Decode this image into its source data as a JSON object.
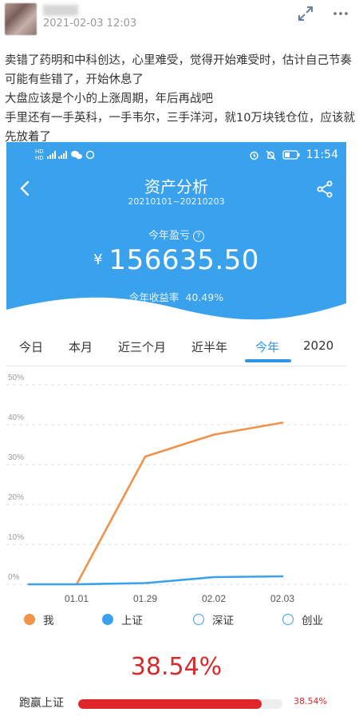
{
  "post": {
    "timestamp": "2021-02-03 12:03",
    "lines": [
      "卖错了药明和中科创达，心里难受，觉得开始难受时，估计自己节奏可能有些错了，开始休息了",
      "大盘应该是个小的上涨周期，年后再战吧",
      "手里还有一手英科，一手韦尔，三手洋河，就10万块钱仓位，应该就先放着了"
    ]
  },
  "phone": {
    "status": {
      "time": "11:54",
      "left_labels": [
        "HD",
        "4G",
        "HD",
        "4G"
      ]
    },
    "header": {
      "title": "资产分析",
      "date_range": "20210101~20210203",
      "profit_label": "今年盈亏",
      "currency": "¥",
      "amount": "156635.50",
      "rate_label": "今年收益率",
      "rate_value": "40.49%"
    },
    "tabs": [
      "今日",
      "本月",
      "近三个月",
      "近半年",
      "今年",
      "2020"
    ],
    "active_tab": "今年",
    "legend": [
      "我",
      "上证",
      "深证",
      "创业"
    ],
    "beat": {
      "big_pct": "38.54%",
      "label": "跑赢上证",
      "pct": "38.54%",
      "fill": 0.9
    },
    "colors": {
      "header_blue": "#3aa1ed",
      "accent": "#2f95e6",
      "me": "#f0924a",
      "sh": "#3aa1ed",
      "red": "#e0252b"
    }
  },
  "chart_data": {
    "type": "line",
    "x": [
      "01.01",
      "01.29",
      "02.02",
      "02.03"
    ],
    "ylim": [
      0,
      50
    ],
    "yticks": [
      "0%",
      "10%",
      "20%",
      "30%",
      "40%",
      "50%"
    ],
    "series": [
      {
        "name": "我",
        "points": [
          [
            0,
            0
          ],
          [
            1,
            32
          ],
          [
            2,
            37.5
          ],
          [
            3,
            40.5
          ]
        ]
      },
      {
        "name": "上证",
        "points": [
          [
            -0.7,
            0
          ],
          [
            0,
            0
          ],
          [
            1,
            0.3
          ],
          [
            2,
            1.8
          ],
          [
            3,
            2.0
          ]
        ]
      }
    ]
  }
}
